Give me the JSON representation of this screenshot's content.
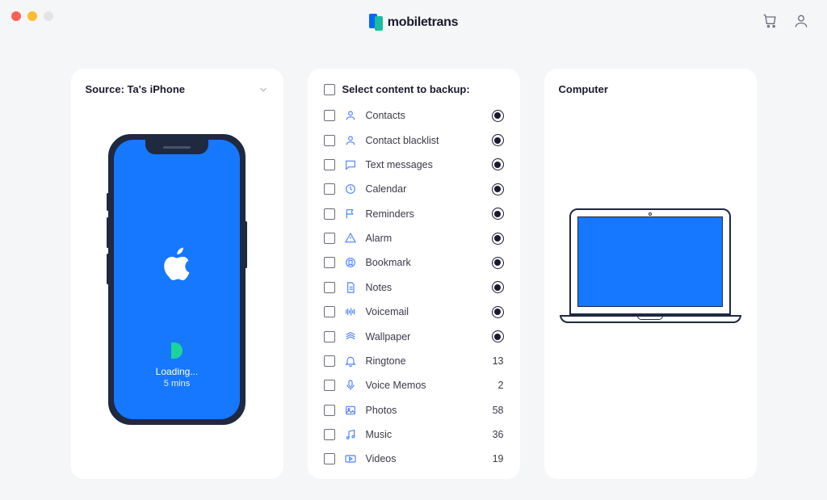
{
  "app": {
    "name": "mobiletrans"
  },
  "header": {
    "cart_icon": "cart-icon",
    "user_icon": "user-icon"
  },
  "source_panel": {
    "title": "Source: Ta's iPhone",
    "loading_label": "Loading...",
    "loading_time": "5 mins"
  },
  "content_panel": {
    "select_label": "Select content to backup:",
    "items": [
      {
        "icon": "contacts-icon",
        "label": "Contacts",
        "status": "loading"
      },
      {
        "icon": "contacts-icon",
        "label": "Contact blacklist",
        "status": "loading"
      },
      {
        "icon": "chat-icon",
        "label": "Text messages",
        "status": "loading"
      },
      {
        "icon": "calendar-icon",
        "label": "Calendar",
        "status": "loading"
      },
      {
        "icon": "flag-icon",
        "label": "Reminders",
        "status": "loading"
      },
      {
        "icon": "alarm-icon",
        "label": "Alarm",
        "status": "loading"
      },
      {
        "icon": "bookmark-icon",
        "label": "Bookmark",
        "status": "loading"
      },
      {
        "icon": "notes-icon",
        "label": "Notes",
        "status": "loading"
      },
      {
        "icon": "voicemail-icon",
        "label": "Voicemail",
        "status": "loading"
      },
      {
        "icon": "wallpaper-icon",
        "label": "Wallpaper",
        "status": "loading"
      },
      {
        "icon": "bell-icon",
        "label": "Ringtone",
        "count": 13
      },
      {
        "icon": "mic-icon",
        "label": "Voice Memos",
        "count": 2
      },
      {
        "icon": "photos-icon",
        "label": "Photos",
        "count": 58
      },
      {
        "icon": "music-icon",
        "label": "Music",
        "count": 36
      },
      {
        "icon": "video-icon",
        "label": "Videos",
        "count": 19
      }
    ]
  },
  "dest_panel": {
    "title": "Computer"
  }
}
